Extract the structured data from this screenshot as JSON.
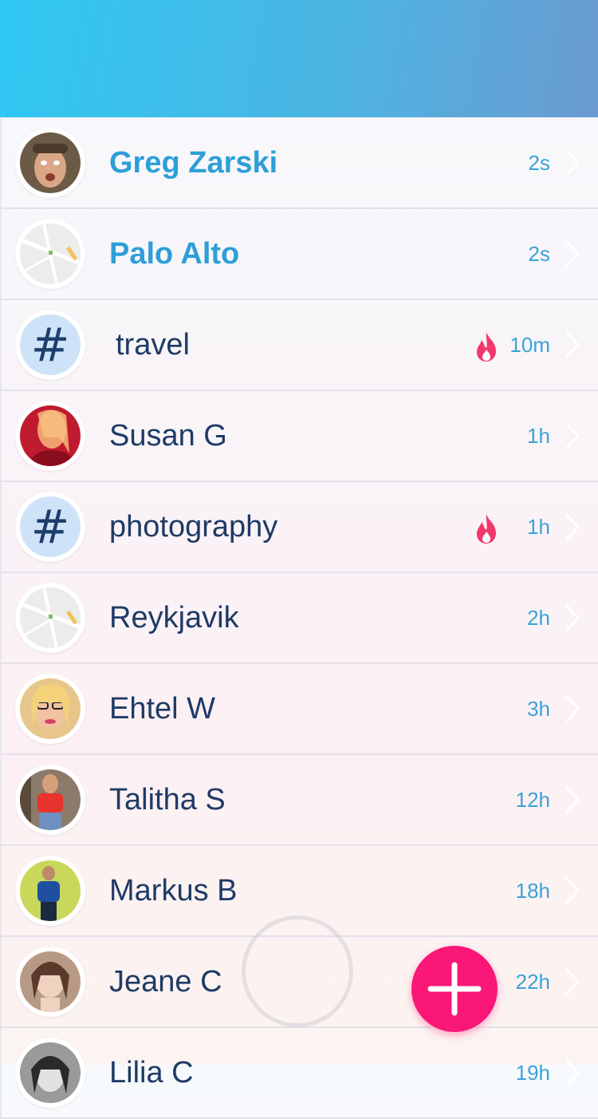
{
  "conversations": [
    {
      "name": "Greg Zarski",
      "time": "2s",
      "unread": true,
      "avatar": "person-photo",
      "hot": false
    },
    {
      "name": "Palo Alto",
      "time": "2s",
      "unread": true,
      "avatar": "map-thumbnail",
      "hot": false
    },
    {
      "name": "travel",
      "time": "10m",
      "unread": false,
      "avatar": "hashtag",
      "hot": true
    },
    {
      "name": "Susan G",
      "time": "1h",
      "unread": false,
      "avatar": "person-photo",
      "hot": false
    },
    {
      "name": "photography",
      "time": "1h",
      "unread": false,
      "avatar": "hashtag",
      "hot": true
    },
    {
      "name": "Reykjavik",
      "time": "2h",
      "unread": false,
      "avatar": "map-thumbnail",
      "hot": false
    },
    {
      "name": "Ehtel W",
      "time": "3h",
      "unread": false,
      "avatar": "person-photo",
      "hot": false
    },
    {
      "name": "Talitha S",
      "time": "12h",
      "unread": false,
      "avatar": "person-photo",
      "hot": false
    },
    {
      "name": "Markus B",
      "time": "18h",
      "unread": false,
      "avatar": "person-photo",
      "hot": false
    },
    {
      "name": "Jeane C",
      "time": "22h",
      "unread": false,
      "avatar": "person-photo",
      "hot": false
    },
    {
      "name": "Lilia C",
      "time": "19h",
      "unread": false,
      "avatar": "person-photo",
      "hot": false
    }
  ],
  "hashtag_symbol": "#",
  "icons": {
    "hot": "flame-icon",
    "row_arrow": "chevron-right-icon",
    "compose": "plus-icon",
    "home": "home-indicator-ring"
  },
  "colors": {
    "header_start": "#2ec8f2",
    "header_end": "#6b9bd0",
    "unread_name": "#2d9fd8",
    "name": "#1f3b66",
    "time": "#3aa2d8",
    "flame": "#f2386a",
    "fab": "#fb1777"
  }
}
